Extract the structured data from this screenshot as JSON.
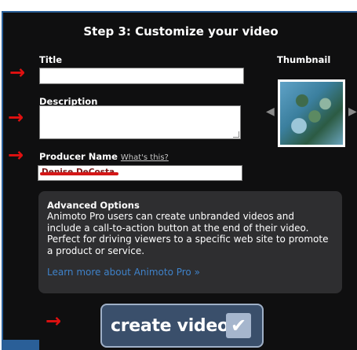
{
  "heading": "Step 3: Customize your video",
  "title_field": {
    "label": "Title",
    "value": ""
  },
  "description_field": {
    "label": "Description",
    "value": ""
  },
  "producer_field": {
    "label": "Producer Name",
    "help_link": "What's this?",
    "value": "Denise DeCosta"
  },
  "thumbnail": {
    "label": "Thumbnail"
  },
  "advanced": {
    "title": "Advanced Options",
    "body": "Animoto Pro users can create unbranded videos and include a call-to-action button at the end of their video. Perfect for driving viewers to a specific web site to promote a product or service.",
    "link": "Learn more about Animoto Pro »"
  },
  "create_button": {
    "label": "create video"
  },
  "icons": {
    "arrow": "→",
    "nav_left": "◀",
    "nav_right": "▶",
    "check": "✔"
  },
  "colors": {
    "panel_bg": "#0f0f10",
    "annotation_red": "#e01010",
    "link_blue": "#3f82c9",
    "button_bg": "#3a4f6b"
  }
}
